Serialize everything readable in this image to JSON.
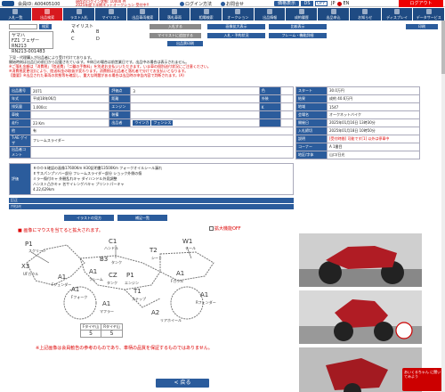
{
  "header": {
    "member": "会員ID: A00405100",
    "notice_line1": "現在のログイン状態: 10000 件",
    "notice_line2": "2025年度下半期ネットオークション 受付中!!",
    "links": [
      "ログイン方法",
      "お問合せ"
    ],
    "price_btn": "価格表示",
    "ds": "DS",
    "off": "OFF",
    "jp": "JP",
    "en": "EN",
    "logout": "ログアウト"
  },
  "nav": [
    {
      "label": "入札一覧",
      "active": false
    },
    {
      "label": "出品検索",
      "active": true
    },
    {
      "label": "ラスト入札",
      "active": false
    },
    {
      "label": "マイリスト",
      "active": false
    },
    {
      "label": "出品車両検索",
      "active": false
    },
    {
      "label": "落札車両",
      "active": false
    },
    {
      "label": "相場検索",
      "active": false
    },
    {
      "label": "オークション",
      "active": false
    },
    {
      "label": "出品情報",
      "active": false
    },
    {
      "label": "成約履歴",
      "active": false
    },
    {
      "label": "出品申込",
      "active": false
    },
    {
      "label": "お知らせ",
      "active": false
    },
    {
      "label": "ディスプレイ",
      "active": false
    },
    {
      "label": "データサービス",
      "active": false
    }
  ],
  "search": {
    "button": "検索"
  },
  "car": {
    "maker": "ヤマハ",
    "model": "FZ1 フェザー RN213",
    "frame": "RN213-001483"
  },
  "mylist": {
    "label": "マイリスト",
    "options": [
      "A",
      "B",
      "C",
      "D"
    ]
  },
  "gray_buttons": [
    "入札する",
    "マイリストに追加する",
    "出品票印刷"
  ],
  "blue_buttons": [
    "画像拡大表示",
    "入札・予約状況",
    "比較表示",
    "フレーム・機能詳細"
  ],
  "right_button": "印刷",
  "messages": [
    {
      "text": "下見・代理購入が出品者により受け付けております。",
      "red": false
    },
    {
      "text": "開始時刻は出品日の前日から記載されています。※休日の場合は前営業日です。出品中の場合は表示されません。",
      "red": false
    },
    {
      "text": "※ご落札金額は「消費税」「陸送費」「二輪の手数料」を別途お支払いいただきます。いま車の個別送付状況にご注意ください。",
      "red": true
    },
    {
      "text": "※消費税変更(旧)により、陸送料金の取扱が変わります。消費税は出品者と落札者で分けてお支払いとなります。",
      "red": true
    },
    {
      "text": "【重要】※出品された車両の状態等を確認し、重大な問題がある場合は出品時の申告内容で判断されます。(A)",
      "red": true
    }
  ],
  "detail": {
    "rows": [
      [
        {
          "k": "出品番号",
          "v": "2071"
        },
        {
          "k": "評価点",
          "v": "3"
        },
        {
          "k": "色",
          "v": ""
        }
      ],
      [
        {
          "k": "年式",
          "v": "平成18年06月"
        },
        {
          "k": "距離",
          "v": ""
        },
        {
          "k": "外装",
          "v": ""
        }
      ],
      [
        {
          "k": "排気量",
          "v": "1,000cc"
        },
        {
          "k": "エンジン",
          "v": ""
        },
        {
          "k": "K",
          "v": ""
        }
      ],
      [
        {
          "k": "車検",
          "v": ""
        },
        {
          "k": "装備",
          "v": ""
        },
        {
          "k": "",
          "v": ""
        }
      ],
      [
        {
          "k": "走行",
          "v": "23 Km"
        },
        {
          "k": "出品者",
          "v": ""
        },
        {
          "k": "",
          "v": ""
        }
      ]
    ],
    "tags": [
      "ウインカ",
      "フェンシス"
    ],
    "memo_label": "他",
    "memo_value": "有",
    "special_label": "T-AE ゲイザ",
    "special_value": "フレームスライダー",
    "comment_label": "出品者コメント"
  },
  "side": {
    "rows": [
      {
        "k": "スタート",
        "v": "30.0万円"
      },
      {
        "k": "結果",
        "v": "成約 40.6万円"
      },
      {
        "k": "地域",
        "v": "1547"
      },
      {
        "k": "会場名",
        "v": "オークネットバイク"
      },
      {
        "k": "開催日",
        "v": "2025年01月16日 13時30分"
      },
      {
        "k": "入札締切",
        "v": "2025年01月18日 10時50分"
      },
      {
        "k": "説明",
        "v": "[受付時間] 可能です[1] 以外は停車中"
      },
      {
        "k": "コーナー",
        "v": "A 1番目"
      },
      {
        "k": "地区/字体",
        "v": "山口/日光"
      }
    ]
  },
  "evaluation": {
    "label": "評価",
    "lines": [
      "ＲＯＯＳ確認の画像17600Km  H30証明書13500Km  フォークオイルシール漏れ",
      "Ｅサスパンプソバー部分  フレームスライダー部分  ショック外側の傷",
      "ミラー傷付キャ  外観乱れキャ  ダイハンドル外見調整",
      "ハンスト凸かキャ  名サイレンゲバキャ  プリントパーキャ",
      "4.22,629km"
    ],
    "correction_label": "訂正",
    "correction_note": "ｱｸｾｽﾒﾓ"
  },
  "tabs": [
    "イラストの見方",
    "補足一覧"
  ],
  "diagram_note": "■ 画像にマウスを当てると拡大されます。",
  "enlarge_label": "拡大機能OFF",
  "diagram": {
    "labels": [
      {
        "code": "P1",
        "text": "スクリーン"
      },
      {
        "code": "X3",
        "text": "UFカウル"
      },
      {
        "code": "A1",
        "text": "Fフェンダー"
      },
      {
        "code": "A1",
        "text": "Fフォーク"
      },
      {
        "code": "C1",
        "text": "ハンドル"
      },
      {
        "code": "B3",
        "text": "タンク"
      },
      {
        "code": "T2",
        "text": "シート"
      },
      {
        "code": "W1",
        "text": "テール"
      },
      {
        "code": "A1",
        "text": "フレーム"
      },
      {
        "code": "CZ",
        "text": "タンク"
      },
      {
        "code": "P1",
        "text": "エンジン"
      },
      {
        "code": "A1",
        "text": "Fカウル"
      },
      {
        "code": "T1",
        "text": "ステップ"
      },
      {
        "code": "A1",
        "text": "マフラー"
      },
      {
        "code": "A2",
        "text": "リアホイール"
      },
      {
        "code": "A1",
        "text": "Rフェンダー"
      }
    ],
    "tire_headers": [
      "Fタイヤ山",
      "Rタイヤ山"
    ],
    "tire_values": [
      "5",
      "5"
    ]
  },
  "bottom_note": "※上記画像は会員勧告の参考のものであり、車柄の品質を保証するものではありません。",
  "back_button": "< 戻る",
  "mascot": "あいくるちゃん に聞いてみよう"
}
